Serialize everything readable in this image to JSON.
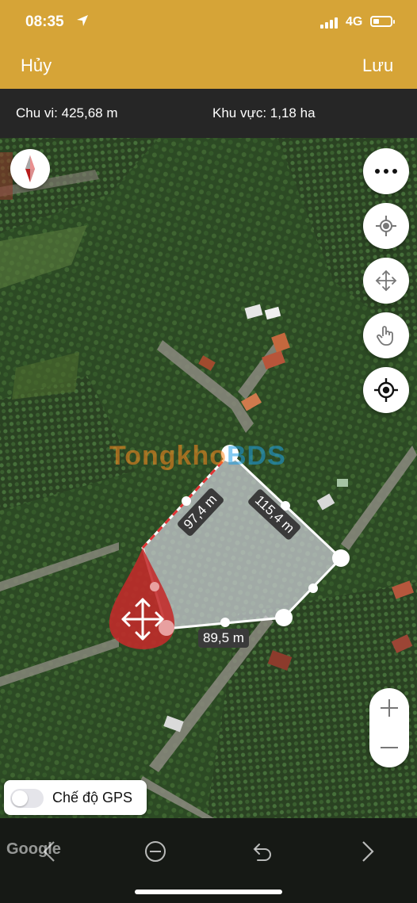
{
  "status": {
    "time": "08:35",
    "network": "4G"
  },
  "nav": {
    "cancel": "Hủy",
    "save": "Lưu"
  },
  "info": {
    "perimeter": "Chu vi: 425,68 m",
    "area": "Khu vực: 1,18 ha"
  },
  "map": {
    "watermark_part1": "Tongkho",
    "watermark_part2": "BDS",
    "distances": {
      "left_edge": "97,4 m",
      "right_edge": "115,4 m",
      "bottom_edge": "89,5 m"
    },
    "gps_label": "Chế độ GPS",
    "gps_enabled": false,
    "google": "Google"
  },
  "icons": {
    "compass": "compass-icon",
    "more": "more-icon",
    "locate": "locate-icon",
    "move": "move-icon",
    "touch": "touch-icon",
    "crosshair": "crosshair-icon",
    "zoom_in": "plus-icon",
    "zoom_out": "minus-icon",
    "prev": "chevron-left-icon",
    "delete": "minus-circle-icon",
    "undo": "undo-icon",
    "next": "chevron-right-icon"
  },
  "colors": {
    "accent": "#d6a437",
    "vertex_selected": "#c42a2a",
    "polygon_fill": "#d9d9e4"
  }
}
